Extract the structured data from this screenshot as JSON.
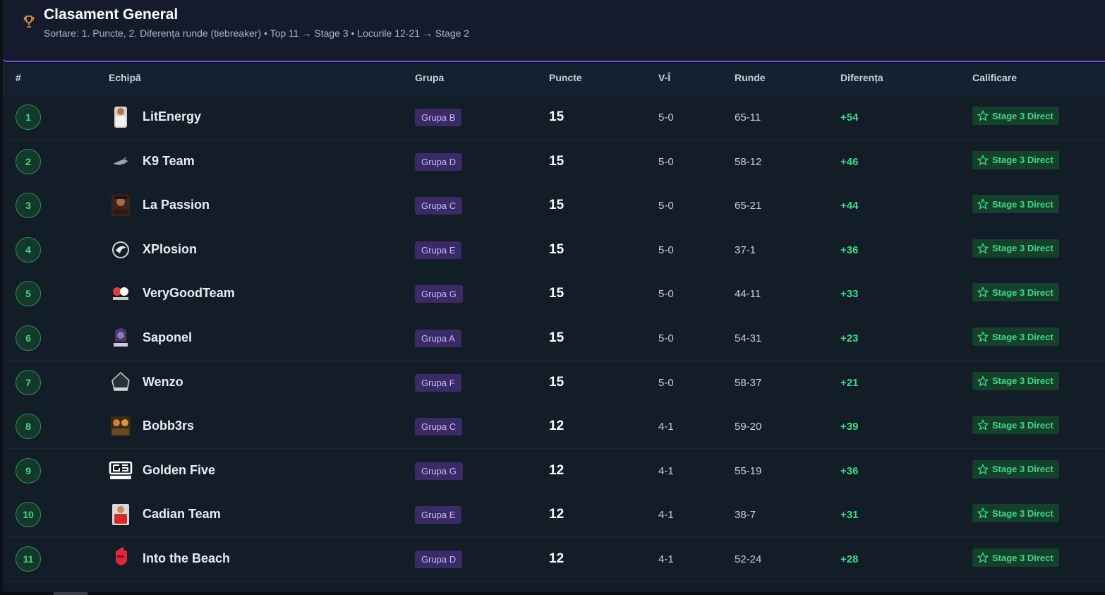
{
  "header": {
    "icon": "trophy-icon",
    "title": "Clasament General",
    "subtitle": "Sortare: 1. Puncte, 2. Diferența runde (tiebreaker) • Top 11 → Stage 3 • Locurile 12-21 → Stage 2"
  },
  "columns": {
    "rank": "#",
    "team": "Echipă",
    "group": "Grupa",
    "points": "Puncte",
    "vi": "V-Î",
    "rounds": "Runde",
    "diff": "Diferența",
    "qualification": "Calificare"
  },
  "rows": [
    {
      "rank": "1",
      "team": "LitEnergy",
      "group": "Grupa B",
      "points": "15",
      "vi": "5-0",
      "rounds": "65-11",
      "diff": "+54",
      "qual": "Stage 3 Direct",
      "logo": "player-photo"
    },
    {
      "rank": "2",
      "team": "K9 Team",
      "group": "Grupa D",
      "points": "15",
      "vi": "5-0",
      "rounds": "58-12",
      "diff": "+46",
      "qual": "Stage 3 Direct",
      "logo": "dog-logo"
    },
    {
      "rank": "3",
      "team": "La Passion",
      "group": "Grupa C",
      "points": "15",
      "vi": "5-0",
      "rounds": "65-21",
      "diff": "+44",
      "qual": "Stage 3 Direct",
      "logo": "la-passion-logo"
    },
    {
      "rank": "4",
      "team": "XPlosion",
      "group": "Grupa E",
      "points": "15",
      "vi": "5-0",
      "rounds": "37-1",
      "diff": "+36",
      "qual": "Stage 3 Direct",
      "logo": "eagle-logo"
    },
    {
      "rank": "5",
      "team": "VeryGoodTeam",
      "group": "Grupa G",
      "points": "15",
      "vi": "5-0",
      "rounds": "44-11",
      "diff": "+33",
      "qual": "Stage 3 Direct",
      "logo": "verygood-logo"
    },
    {
      "rank": "6",
      "team": "Saponel",
      "group": "Grupa A",
      "points": "15",
      "vi": "5-0",
      "rounds": "54-31",
      "diff": "+23",
      "qual": "Stage 3 Direct",
      "logo": "saponel-logo"
    },
    {
      "rank": "7",
      "team": "Wenzo",
      "group": "Grupa F",
      "points": "15",
      "vi": "5-0",
      "rounds": "58-37",
      "diff": "+21",
      "qual": "Stage 3 Direct",
      "logo": "wenzo-logo"
    },
    {
      "rank": "8",
      "team": "Bobb3rs",
      "group": "Grupa C",
      "points": "12",
      "vi": "4-1",
      "rounds": "59-20",
      "diff": "+39",
      "qual": "Stage 3 Direct",
      "logo": "bobb3rs-logo"
    },
    {
      "rank": "9",
      "team": "Golden Five",
      "group": "Grupa G",
      "points": "12",
      "vi": "4-1",
      "rounds": "55-19",
      "diff": "+36",
      "qual": "Stage 3 Direct",
      "logo": "golden-five-logo"
    },
    {
      "rank": "10",
      "team": "Cadian Team",
      "group": "Grupa E",
      "points": "12",
      "vi": "4-1",
      "rounds": "38-7",
      "diff": "+31",
      "qual": "Stage 3 Direct",
      "logo": "player-red-photo"
    },
    {
      "rank": "11",
      "team": "Into the Beach",
      "group": "Grupa D",
      "points": "12",
      "vi": "4-1",
      "rounds": "52-24",
      "diff": "+28",
      "qual": "Stage 3 Direct",
      "logo": "knight-logo"
    }
  ],
  "colors": {
    "accent": "#7c4ddc",
    "qualified": "#3fd98a",
    "group_badge": "#3a2a66"
  }
}
